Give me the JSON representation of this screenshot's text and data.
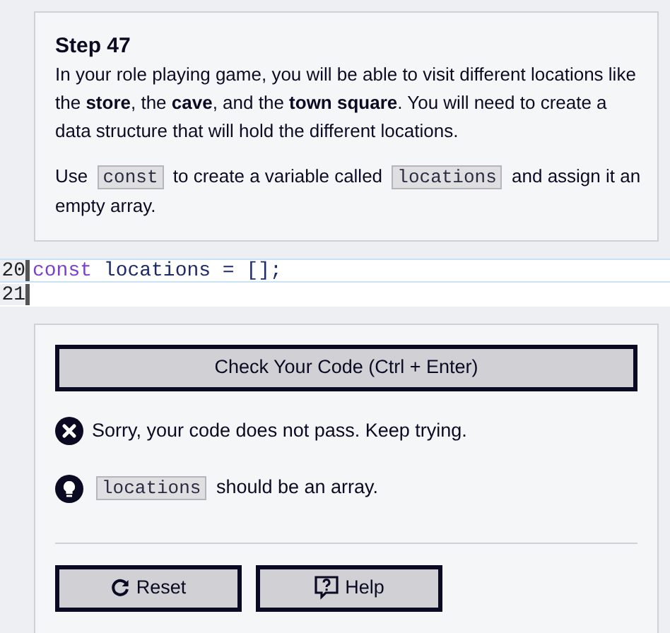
{
  "step": {
    "title": "Step 47",
    "paragraphs": [
      [
        {
          "kind": "text",
          "text": "In your role playing game, you will be able to visit different locations like the **store**, the **cave**, and the **town square**. You will need to create a data structure that will hold the different locations."
        }
      ],
      [
        {
          "kind": "text",
          "text": "Use"
        },
        {
          "kind": "code",
          "text": "const"
        },
        {
          "kind": "text",
          "text": "to create a variable called"
        },
        {
          "kind": "code",
          "text": "locations"
        },
        {
          "kind": "text",
          "text": "and assign it an empty array."
        }
      ]
    ]
  },
  "editor": {
    "lines": [
      {
        "number": "20",
        "active": true,
        "tokens": [
          {
            "kind": "keyword",
            "text": "const"
          },
          {
            "kind": "plain",
            "text": " locations = [];"
          }
        ]
      },
      {
        "number": "21",
        "active": false
      }
    ]
  },
  "check_button": "Check Your Code (Ctrl + Enter)",
  "messages": [
    {
      "kind": "error",
      "parts": [
        {
          "kind": "text",
          "text": "Sorry, your code does not pass. Keep trying."
        }
      ]
    },
    {
      "kind": "hint",
      "parts": [
        {
          "kind": "code",
          "text": "locations"
        },
        {
          "kind": "text",
          "text": "should be an array."
        }
      ]
    }
  ],
  "buttons": [
    {
      "kind": "reset",
      "label": "Reset"
    },
    {
      "kind": "help",
      "label": "Help"
    }
  ]
}
